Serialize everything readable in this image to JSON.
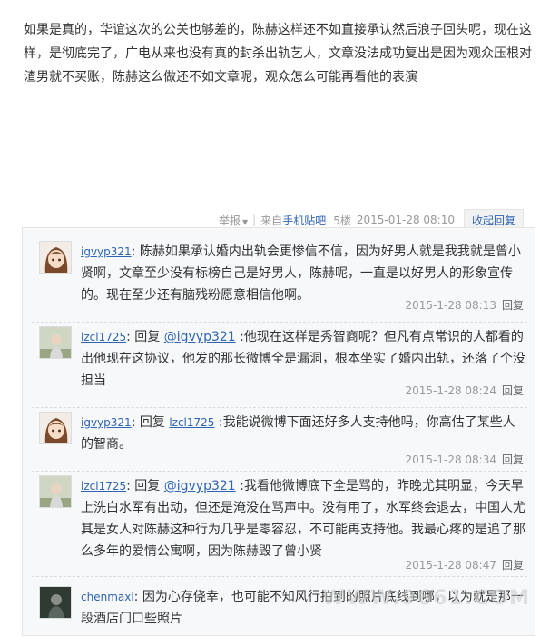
{
  "post": {
    "text": "如果是真的，华谊这次的公关也够差的，陈赫这样还不如直接承认然后浪子回头呢，现在这样，是彻底完了，广电从来也没有真的封杀出轨艺人，文章没法成功复出是因为观众压根对渣男就不买账，陈赫这么做还不如文章呢，观众怎么可能再看他的表演",
    "tail": {
      "report_label": "举报",
      "from_label": "来自",
      "client_label": "手机贴吧",
      "floor": "5楼",
      "time": "2015-01-28 08:10",
      "toggle_label": "收起回复"
    }
  },
  "replies": [
    {
      "user": "igvyp321",
      "avatar": "girl-avatar",
      "prefix": "",
      "target": "",
      "text": "陈赫如果承认婚内出轨会更惨信不信，因为好男人就是我我就是曾小贤啊，文章至少没有标榜自己是好男人，陈赫呢，一直是以好男人的形象宣传的。现在至少还有脑残粉愿意相信他啊。",
      "time": "2015-1-28 08:13",
      "reply_label": "回复"
    },
    {
      "user": "lzcl1725",
      "avatar": "child-avatar",
      "prefix": "回复",
      "target": "@igvyp321",
      "text": ":他现在这样是秀智商呢？但凡有点常识的人都看的出他现在这协议，他发的那长微博全是漏洞，根本坐实了婚内出轨，还落了个没担当",
      "time": "2015-1-28 08:24",
      "reply_label": "回复"
    },
    {
      "user": "igvyp321",
      "avatar": "girl-avatar",
      "prefix": "回复",
      "target": "lzcl1725",
      "text": ":我能说微博下面还好多人支持他吗，你高估了某些人的智商。",
      "time": "2015-1-28 08:34",
      "reply_label": "回复"
    },
    {
      "user": "lzcl1725",
      "avatar": "child-avatar",
      "prefix": "回复",
      "target": "@igvyp321",
      "text": ":我看他微博底下全是骂的，昨晚尤其明显，今天早上洗白水军有出动，但还是淹没在骂声中。没有用了，水军终会退去，中国人尤其是女人对陈赫这种行为几乎是零容忍，不可能再支持他。我最心疼的是追了那么多年的爱情公寓啊，因为陈赫毁了曾小贤",
      "time": "2015-1-28 08:47",
      "reply_label": "回复"
    },
    {
      "user": "chenmaxl",
      "avatar": "dark-avatar",
      "prefix": "",
      "target": "",
      "text": "因为心存侥幸，也可能不知风行拍到的照片底线到哪，以为就是那一段酒店门口些照片",
      "time": "",
      "reply_label": ""
    }
  ],
  "watermark": "WWW.9661.COM",
  "colors": {
    "link": "#2d64b3",
    "lzl_bg": "#f7f8fa",
    "meta": "#999999"
  }
}
